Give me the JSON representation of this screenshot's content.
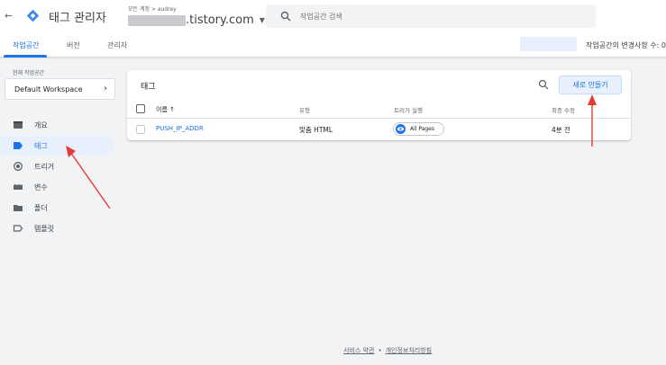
{
  "header": {
    "back_icon": "arrow-left-icon",
    "app_title": "태그 관리자",
    "account_crumb": "모든 계정 > audrey",
    "container_domain": ".tistory.com",
    "search_placeholder": "작업공간 검색"
  },
  "tabs": [
    {
      "label": "작업공간",
      "active": true
    },
    {
      "label": "버전",
      "active": false
    },
    {
      "label": "관리자",
      "active": false
    }
  ],
  "status_text": "작업공간의 변경사항 수: 0",
  "workspace": {
    "label": "현재 작업공간",
    "name": "Default Workspace"
  },
  "sidebar": {
    "items": [
      {
        "label": "개요",
        "icon": "overview-icon",
        "active": false
      },
      {
        "label": "태그",
        "icon": "tag-icon",
        "active": true
      },
      {
        "label": "트리거",
        "icon": "trigger-icon",
        "active": false
      },
      {
        "label": "변수",
        "icon": "variable-icon",
        "active": false
      },
      {
        "label": "폴더",
        "icon": "folder-icon",
        "active": false
      },
      {
        "label": "템플릿",
        "icon": "template-icon",
        "active": false
      }
    ]
  },
  "tags_card": {
    "title": "태그",
    "new_button": "새로 만들기",
    "columns": [
      "이름 ↑",
      "유형",
      "트리거 실행",
      "최종 수정"
    ],
    "rows": [
      {
        "name": "PUSH_IP_ADDR",
        "type": "맞춤 HTML",
        "trigger": "All Pages",
        "modified": "4분 전"
      }
    ]
  },
  "footer": {
    "terms": "서비스 약관",
    "separator": "•",
    "privacy": "개인정보처리방침"
  },
  "colors": {
    "accent": "#1a73e8",
    "annotation_arrow": "#e53935"
  }
}
